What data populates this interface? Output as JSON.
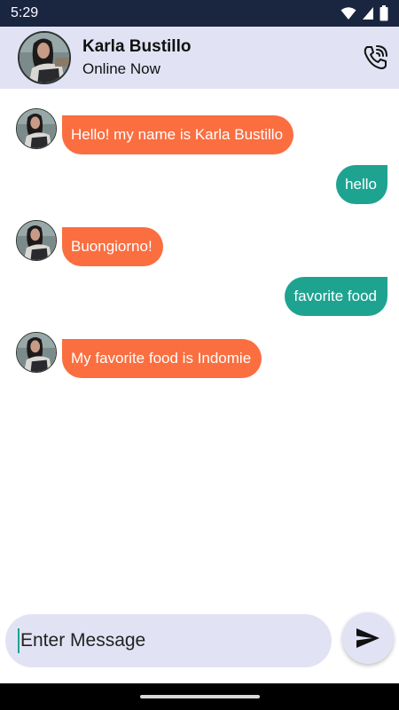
{
  "status_bar": {
    "time": "5:29",
    "icons": [
      "wifi-icon",
      "cellular-signal-icon",
      "battery-icon"
    ]
  },
  "header": {
    "contact_name": "Karla Bustillo",
    "status": "Online Now",
    "call_icon": "phone-call-icon"
  },
  "messages": [
    {
      "direction": "incoming",
      "text": "Hello! my name is Karla Bustillo"
    },
    {
      "direction": "outgoing",
      "text": "hello"
    },
    {
      "direction": "incoming",
      "text": "Buongiorno!"
    },
    {
      "direction": "outgoing",
      "text": "favorite food"
    },
    {
      "direction": "incoming",
      "text": "My favorite food is Indomie"
    }
  ],
  "composer": {
    "placeholder": "Enter Message",
    "send_icon": "send-icon"
  },
  "colors": {
    "incoming_bubble": "#fa6e40",
    "outgoing_bubble": "#1fa391",
    "header_bg": "#e1e3f4",
    "status_bar_bg": "#1a2540"
  }
}
